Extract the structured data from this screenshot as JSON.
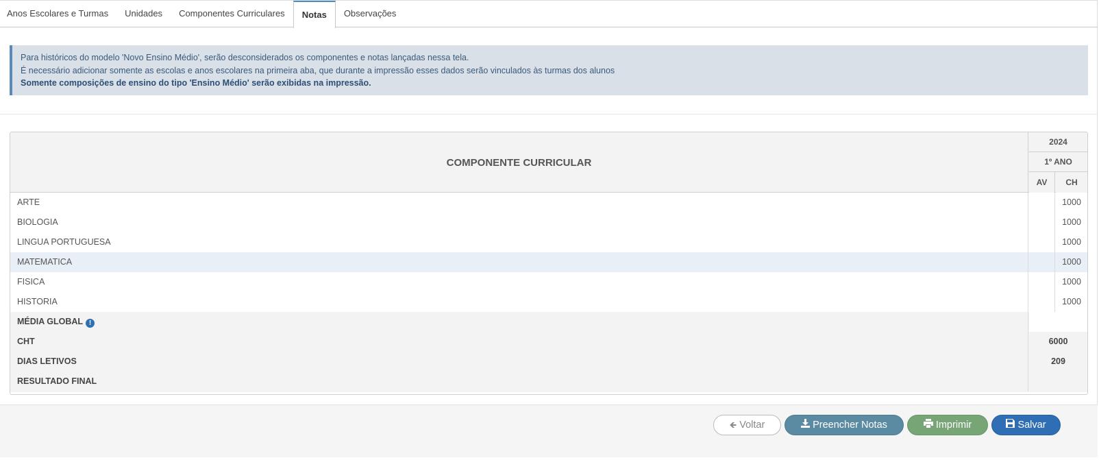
{
  "tabs": [
    {
      "label": "Anos Escolares e Turmas"
    },
    {
      "label": "Unidades"
    },
    {
      "label": "Componentes Curriculares"
    },
    {
      "label": "Notas",
      "active": true
    },
    {
      "label": "Observações"
    }
  ],
  "alert": {
    "line1": "Para históricos do modelo 'Novo Ensino Médio', serão desconsiderados os componentes e notas lançadas nessa tela.",
    "line2": "É necessário adicionar somente as escolas e anos escolares na primeira aba, que durante a impressão esses dados serão vinculados às turmas dos alunos",
    "line3": "Somente composições de ensino do tipo 'Ensino Médio' serão exibidas na impressão."
  },
  "table": {
    "header": "COMPONENTE CURRICULAR",
    "year": "2024",
    "grade": "1º ANO",
    "col_av": "AV",
    "col_ch": "CH",
    "rows": [
      {
        "name": "ARTE",
        "av": "",
        "ch": "1000"
      },
      {
        "name": "BIOLOGIA",
        "av": "",
        "ch": "1000"
      },
      {
        "name": "LINGUA PORTUGUESA",
        "av": "",
        "ch": "1000"
      },
      {
        "name": "MATEMATICA",
        "av": "",
        "ch": "1000"
      },
      {
        "name": "FISICA",
        "av": "",
        "ch": "1000"
      },
      {
        "name": "HISTORIA",
        "av": "",
        "ch": "1000"
      }
    ],
    "summary": {
      "media_label": "MÉDIA GLOBAL",
      "media_value": "",
      "cht_label": "CHT",
      "cht_value": "6000",
      "dias_label": "DIAS LETIVOS",
      "dias_value": "209",
      "resultado_label": "RESULTADO FINAL",
      "resultado_value": ""
    }
  },
  "buttons": {
    "back": "Voltar",
    "fill": "Preencher Notas",
    "print": "Imprimir",
    "save": "Salvar"
  },
  "icons": {
    "info": "exclamation-circle-icon",
    "back": "arrow-left-icon",
    "fill": "download-icon",
    "print": "printer-icon",
    "save": "floppy-disk-icon"
  }
}
